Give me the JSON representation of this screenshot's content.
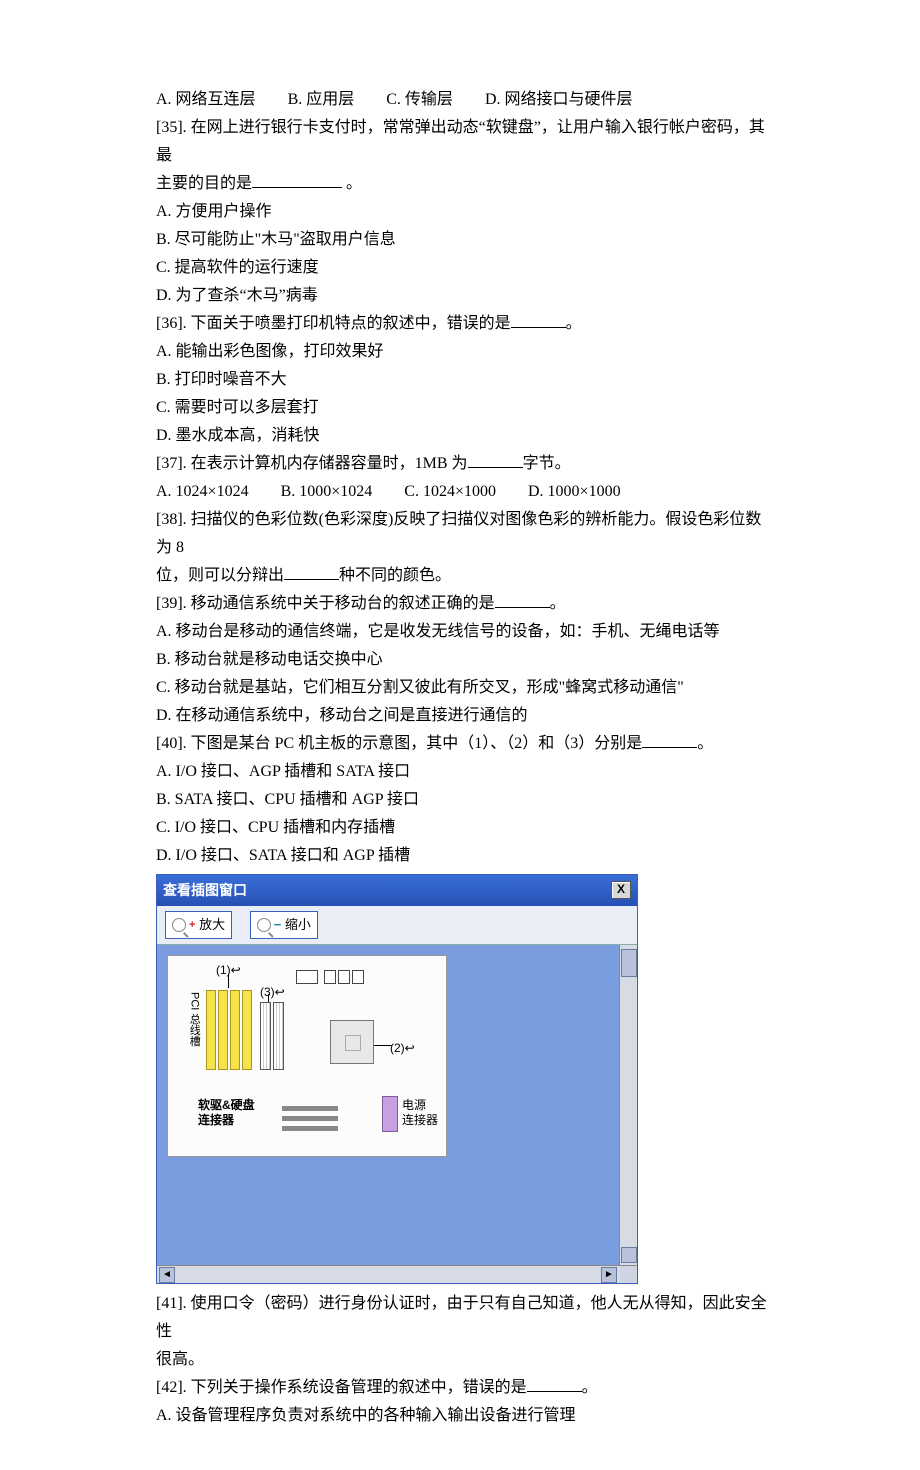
{
  "q34": {
    "opts": {
      "A": "A.   网络互连层",
      "B": "B.  应用层",
      "C": "C. 传输层",
      "D": "D.  网络接口与硬件层"
    }
  },
  "q35": {
    "stem1": "[35]. 在网上进行银行卡支付时，常常弹出动态“软键盘”，让用户输入银行帐户密码，其最",
    "stem2": "主要的目的是",
    "tail": " 。",
    "opts": {
      "A": "A.    方便用户操作",
      "B": "B.    尽可能防止\"木马\"盗取用户信息",
      "C": "C.    提高软件的运行速度",
      "D": "D.    为了查杀“木马”病毒"
    }
  },
  "q36": {
    "stem": "[36]. 下面关于喷墨打印机特点的叙述中，错误的是",
    "tail": "。",
    "opts": {
      "A": "A.    能输出彩色图像，打印效果好",
      "B": "B.    打印时噪音不大",
      "C": "C.    需要时可以多层套打",
      "D": "D.    墨水成本高，消耗快"
    }
  },
  "q37": {
    "stem": "[37]. 在表示计算机内存储器容量时，1MB 为",
    "tail": "字节。",
    "opts": {
      "A": "A.   1024×1024",
      "B": "B. 1000×1024",
      "C": "C. 1024×1000",
      "D": "D. 1000×1000"
    }
  },
  "q38": {
    "stem1": "[38]. 扫描仪的色彩位数(色彩深度)反映了扫描仪对图像色彩的辨析能力。假设色彩位数为 8",
    "stem2": "位，则可以分辩出",
    "tail": "种不同的颜色。"
  },
  "q39": {
    "stem": "[39]. 移动通信系统中关于移动台的叙述正确的是",
    "tail": "。",
    "opts": {
      "A": "A.    移动台是移动的通信终端，它是收发无线信号的设备，如：手机、无绳电话等",
      "B": "B.    移动台就是移动电话交换中心",
      "C": "C.    移动台就是基站，它们相互分割又彼此有所交叉，形成\"蜂窝式移动通信\"",
      "D": "D.    在移动通信系统中，移动台之间是直接进行通信的"
    }
  },
  "q40": {
    "stem": "[40]. 下图是某台 PC 机主板的示意图，其中（1）、（2）和（3）分别是",
    "tail": "。",
    "opts": {
      "A": "A.   I/O 接口、AGP 插槽和 SATA 接口",
      "B": "B.   SATA 接口、CPU 插槽和 AGP 接口",
      "C": "C.   I/O 接口、CPU 插槽和内存插槽",
      "D": "D.   I/O 接口、SATA 接口和 AGP 插槽"
    }
  },
  "viewer": {
    "title": "查看插图窗口",
    "zoom_in": "放大",
    "zoom_out": "缩小",
    "close": "X",
    "labels": {
      "l1": "(1)↩",
      "l2": "(2)↩",
      "l3": "(3)↩",
      "pci": "PCI 总线槽",
      "pwr_line1": "电源",
      "pwr_line2": "连接器",
      "hd_line1": "软驱&硬盘",
      "hd_line2": "连接器"
    }
  },
  "q41": {
    "stem1": "[41]. 使用口令（密码）进行身份认证时，由于只有自己知道，他人无从得知，因此安全性",
    "stem2": "很高。"
  },
  "q42": {
    "stem": "[42]. 下列关于操作系统设备管理的叙述中，错误的是",
    "tail": "。",
    "opts": {
      "A": "A.    设备管理程序负责对系统中的各种输入输出设备进行管理"
    }
  }
}
